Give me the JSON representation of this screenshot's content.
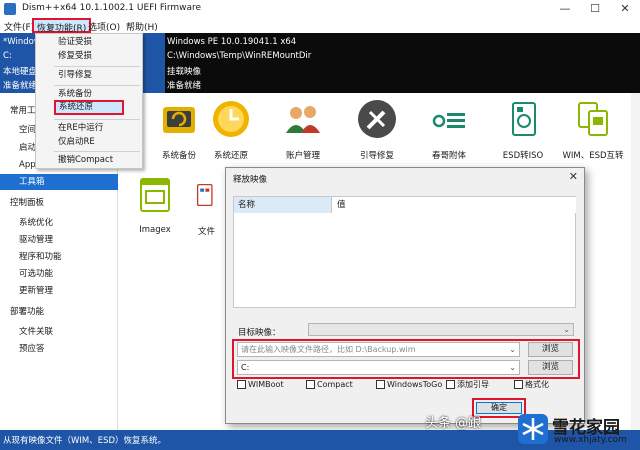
{
  "window": {
    "title": "Dism++x64 10.1.1002.1 UEFI Firmware",
    "controls": {
      "minimize": "—",
      "maximize": "☐",
      "close": "✕"
    }
  },
  "menubar": {
    "file": "文件(F)",
    "recovery": "恢复功能(R)",
    "options": "选项(O)",
    "help": "帮助(H)"
  },
  "recovery_menu": {
    "items": [
      "验证受损",
      "修复受损",
      "引导修复",
      "系统备份",
      "系统还原",
      "在RE中运行",
      "仅启动RE",
      "撤销Compact"
    ]
  },
  "header": {
    "left_lines": [
      "*Window",
      "C:",
      "本地硬盘",
      "准备就绪"
    ],
    "info_lines": [
      "Windows PE 10.0.19041.1 x64",
      "C:\\Windows\\Temp\\WinREMountDir",
      "挂载映像",
      "准备就绪"
    ]
  },
  "sidebar": {
    "items": [
      "常用工具",
      "空间",
      "启动",
      "App",
      "工具箱",
      "控制面板",
      "系统优化",
      "驱动管理",
      "程序和功能",
      "可选功能",
      "更新管理",
      "部署功能",
      "文件关联",
      "预应答"
    ]
  },
  "toolbox": {
    "tools": [
      "系统备份",
      "系统还原",
      "账户管理",
      "引导修复",
      "春哥附体",
      "ESD转ISO",
      "WIM、ESD互转",
      "Imagex",
      "文件"
    ]
  },
  "dialog": {
    "title": "释放映像",
    "close": "✕",
    "columns": [
      "名称",
      "值"
    ],
    "target_label": "目标映像：",
    "path_placeholder": "请在此输入映像文件路径，比如 D:\\Backup.wim",
    "drive_value": "C:",
    "browse_label": "浏览",
    "checkboxes": [
      "WIMBoot",
      "Compact",
      "WindowsToGo",
      "添加引导",
      "格式化"
    ],
    "ok_label": "确定"
  },
  "statusbar": {
    "text": "从现有映像文件（WIM、ESD）恢复系统。"
  },
  "watermark": {
    "left": "头条 @跟",
    "brand": "雪花家园",
    "url": "www.xhjaty.com"
  }
}
